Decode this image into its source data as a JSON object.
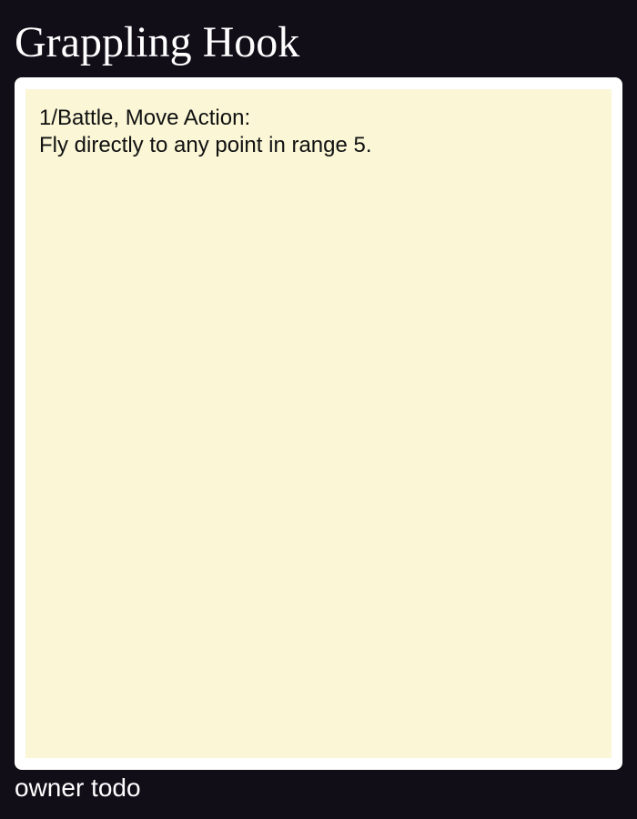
{
  "card": {
    "title": "Grappling Hook",
    "ability": {
      "header": "1/Battle, Move Action:",
      "text": "Fly directly to any point in range 5."
    },
    "owner": "owner todo"
  },
  "colors": {
    "page_background": "#110e18",
    "frame": "#ffffff",
    "body_background": "#faf6d6",
    "title_text": "#ffffff",
    "body_text": "#111111"
  }
}
